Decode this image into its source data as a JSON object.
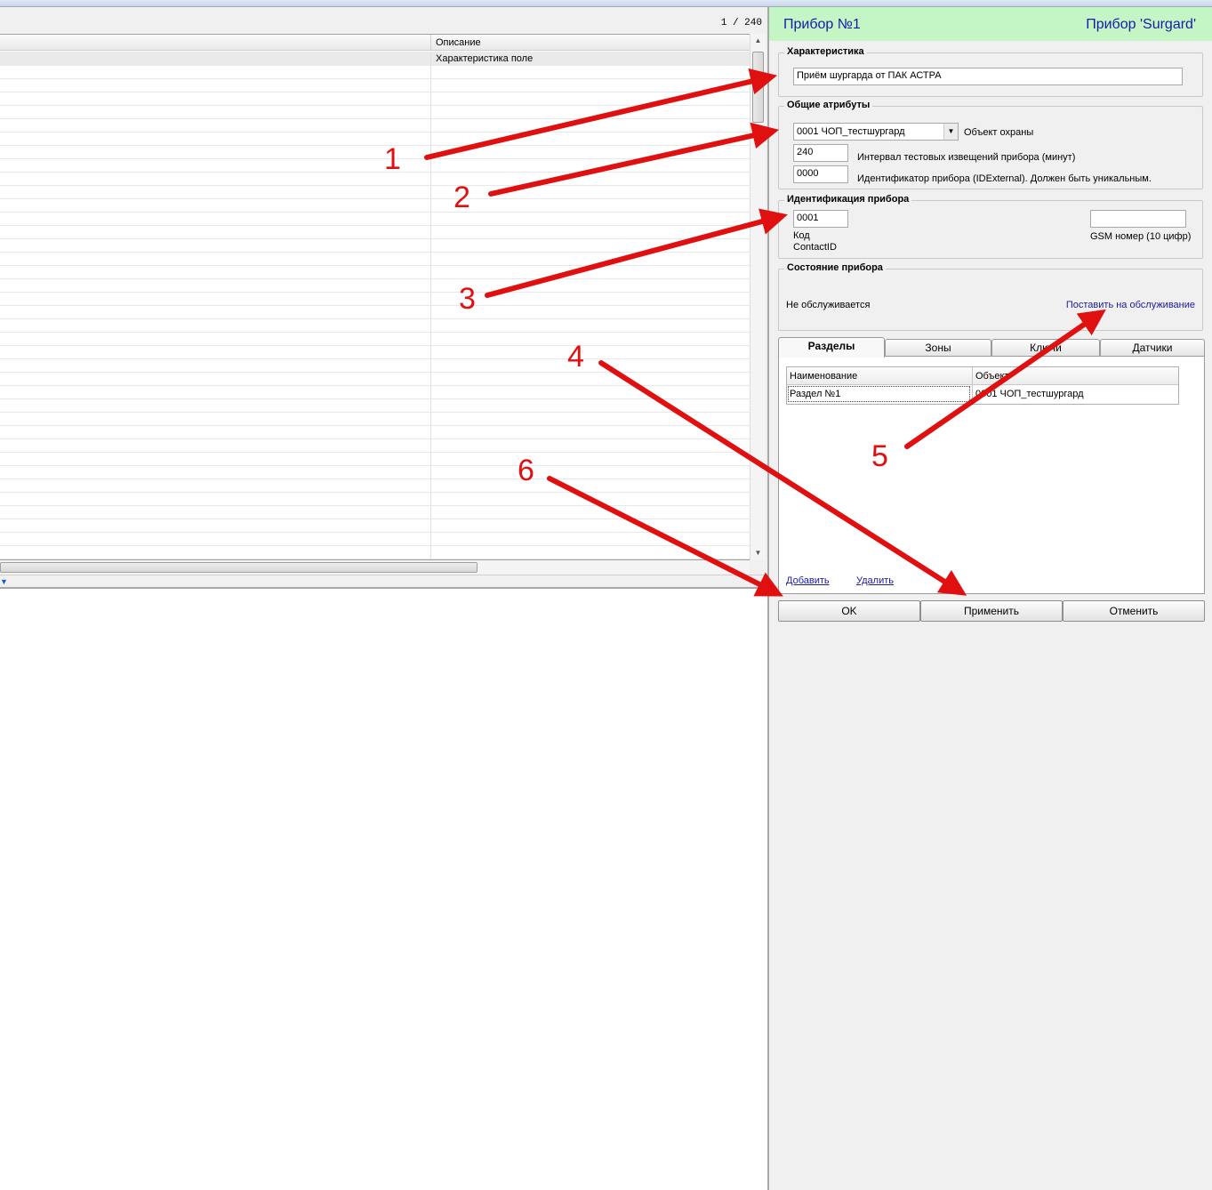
{
  "left": {
    "counter": "1 / 240",
    "column_description": "Описание",
    "row0_description": "Характеристика поле"
  },
  "device": {
    "title": "Прибор №1",
    "type": "Прибор 'Surgard'"
  },
  "characteristic": {
    "legend": "Характеристика",
    "value": "Приём шургарда от ПАК АСТРА"
  },
  "common": {
    "legend": "Общие атрибуты",
    "object_value": "0001 ЧОП_тестшургард",
    "object_label": "Объект охраны",
    "interval_value": "240",
    "interval_label": "Интервал тестовых извещений прибора (минут)",
    "id_value": "0000",
    "id_label": "Идентификатор прибора  (IDExternal).    Должен быть уникальным."
  },
  "identification": {
    "legend": "Идентификация прибора",
    "code_value": "0001",
    "code_label_1": "Код",
    "code_label_2": "ContactID",
    "gsm_value": "",
    "gsm_label": "GSM номер (10 цифр)"
  },
  "state": {
    "legend": "Состояние прибора",
    "status": "Не обслуживается",
    "action": "Поставить на обслуживание"
  },
  "tabs": [
    "Разделы",
    "Зоны",
    "Ключи",
    "Датчики"
  ],
  "sections_table": {
    "headers": [
      "Наименование",
      "Объект"
    ],
    "rows": [
      [
        "Раздел №1",
        "0001 ЧОП_тестшургард"
      ]
    ]
  },
  "links": {
    "add": "Добавить",
    "delete": "Удалить"
  },
  "buttons": {
    "ok": "OK",
    "apply": "Применить",
    "cancel": "Отменить"
  },
  "annotations": {
    "color": "#e01010",
    "labels": [
      "1",
      "2",
      "3",
      "4",
      "5",
      "6"
    ]
  }
}
